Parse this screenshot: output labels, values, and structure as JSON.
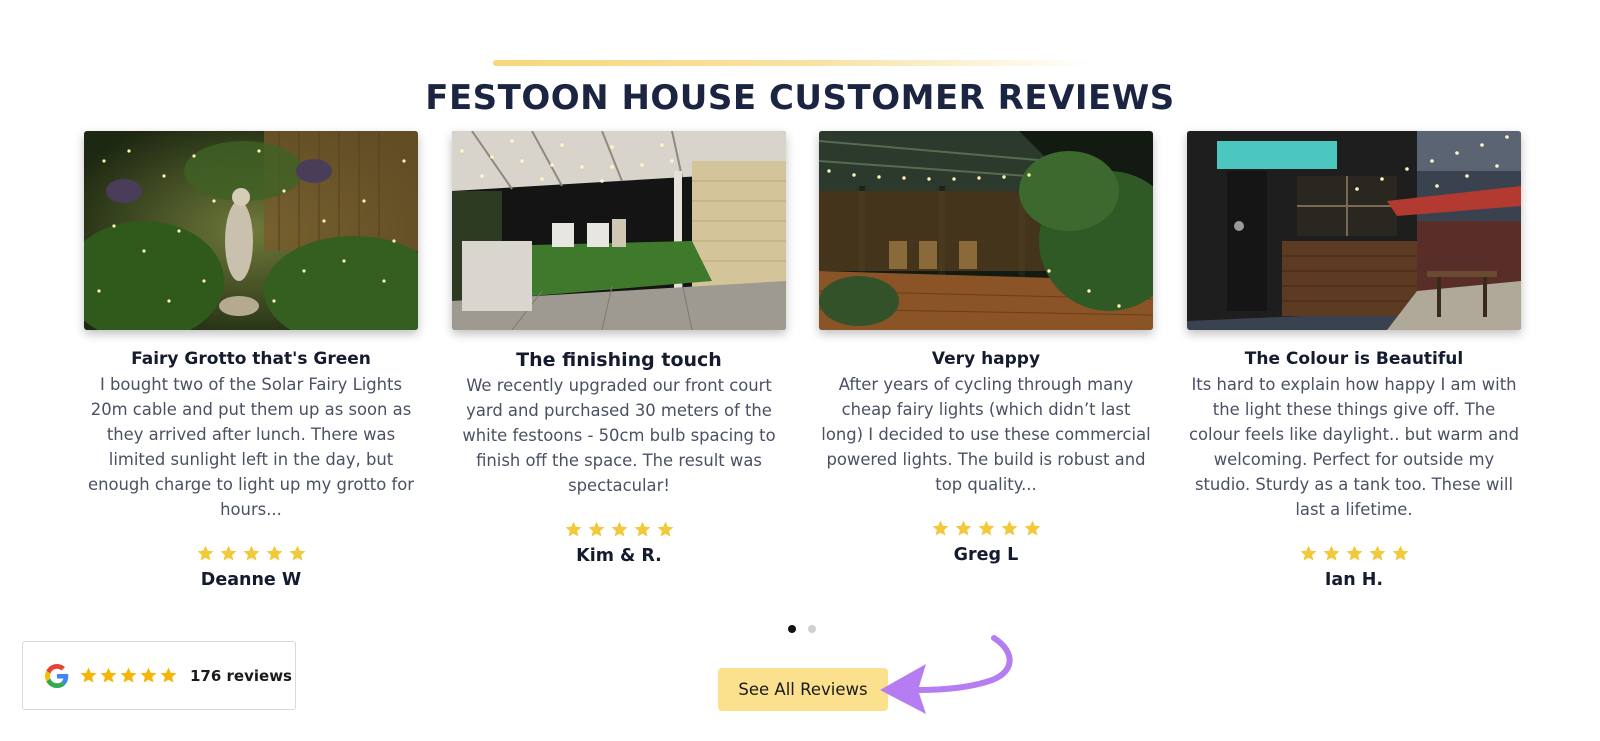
{
  "section": {
    "title": "FESTOON HOUSE CUSTOMER REVIEWS"
  },
  "reviews": [
    {
      "title": "Fairy Grotto that's Green",
      "body": "I bought two of the Solar Fairy Lights 20m cable and put them up as soon as they arrived after lunch. There was limited sunlight left in the day, but enough charge to light up my grotto for hours...",
      "rating": 5,
      "reviewer": "Deanne W",
      "image": "garden-grotto-photo"
    },
    {
      "title": "The finishing touch",
      "body": "We recently upgraded our front court yard and purchased 30 meters of the white festoons - 50cm bulb spacing to finish off the space. The result was spectacular!",
      "rating": 5,
      "reviewer": "Kim & R.",
      "image": "courtyard-pergola-photo"
    },
    {
      "title": "Very happy",
      "body": "After years of cycling through many cheap fairy lights (which didn’t last long) I decided to use these commercial powered lights. The build is robust and top quality...",
      "rating": 5,
      "reviewer": "Greg L",
      "image": "gazebo-deck-photo"
    },
    {
      "title": "The Colour is Beautiful",
      "body": "Its hard to explain how happy I am with the light these things give off. The colour feels like daylight.. but warm and welcoming. Perfect for outside my studio. Sturdy as a tank too. These will last a lifetime.",
      "rating": 5,
      "reviewer": "Ian H.",
      "image": "studio-bar-photo"
    }
  ],
  "carousel": {
    "current_page": 1,
    "total_pages": 2
  },
  "google_badge": {
    "icon": "google-g-icon",
    "rating": 5,
    "count_label": "176 reviews"
  },
  "cta": {
    "see_all_label": "See All Reviews"
  },
  "colors": {
    "heading": "#1b2440",
    "star": "#f1c93b",
    "badge_star": "#f5b50a",
    "button_bg": "#fbe08d",
    "arrow": "#b67cf2"
  }
}
